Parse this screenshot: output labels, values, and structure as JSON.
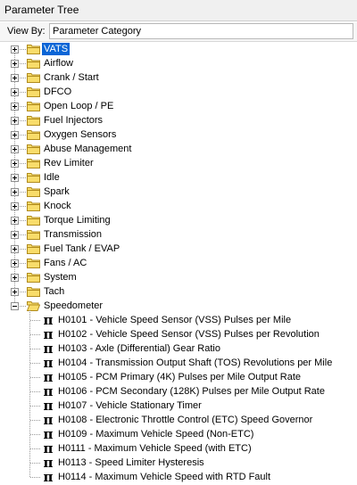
{
  "window": {
    "title": "Parameter Tree"
  },
  "view_by": {
    "label": "View By:",
    "value": "Parameter Category"
  },
  "categories": [
    {
      "label": "VATS",
      "selected": true
    },
    {
      "label": "Airflow"
    },
    {
      "label": "Crank / Start"
    },
    {
      "label": "DFCO"
    },
    {
      "label": "Open Loop / PE"
    },
    {
      "label": "Fuel Injectors"
    },
    {
      "label": "Oxygen Sensors"
    },
    {
      "label": "Abuse Management"
    },
    {
      "label": "Rev Limiter"
    },
    {
      "label": "Idle"
    },
    {
      "label": "Spark"
    },
    {
      "label": "Knock"
    },
    {
      "label": "Torque Limiting"
    },
    {
      "label": "Transmission"
    },
    {
      "label": "Fuel Tank / EVAP"
    },
    {
      "label": "Fans / AC"
    },
    {
      "label": "System"
    },
    {
      "label": "Tach"
    },
    {
      "label": "Speedometer",
      "expanded": true
    }
  ],
  "speedometer_params": [
    {
      "icon": "π",
      "label": "H0101 - Vehicle Speed Sensor (VSS) Pulses per Mile"
    },
    {
      "icon": "π",
      "label": "H0102 - Vehicle Speed Sensor (VSS) Pulses per Revolution"
    },
    {
      "icon": "π",
      "label": "H0103 - Axle (Differential) Gear Ratio"
    },
    {
      "icon": "π",
      "label": "H0104 - Transmission Output Shaft (TOS) Revolutions per Mile"
    },
    {
      "icon": "π",
      "label": "H0105 - PCM Primary (4K) Pulses per Mile Output Rate"
    },
    {
      "icon": "π",
      "label": "H0106 - PCM Secondary (128K) Pulses per Mile Output Rate"
    },
    {
      "icon": "π",
      "label": "H0107 - Vehicle Stationary Timer"
    },
    {
      "icon": "π",
      "label": "H0108 - Electronic Throttle Control (ETC) Speed Governor"
    },
    {
      "icon": "π",
      "label": "H0109 - Maximum Vehicle Speed (Non-ETC)"
    },
    {
      "icon": "π",
      "label": "H0111 - Maximum Vehicle Speed (with ETC)"
    },
    {
      "icon": "π",
      "label": "H0113 - Speed Limiter Hysteresis"
    },
    {
      "icon": "π",
      "label": "H0114 - Maximum Vehicle Speed with RTD Fault"
    }
  ],
  "colors": {
    "selection": "#0a65d6",
    "folder_fill": "#f8dc6a",
    "folder_stroke": "#b08b1e"
  },
  "icons": {
    "expand": "plus-box-icon",
    "collapse": "minus-box-icon",
    "folder": "folder-icon",
    "open_folder": "open-folder-icon",
    "parameter": "pi-icon"
  }
}
